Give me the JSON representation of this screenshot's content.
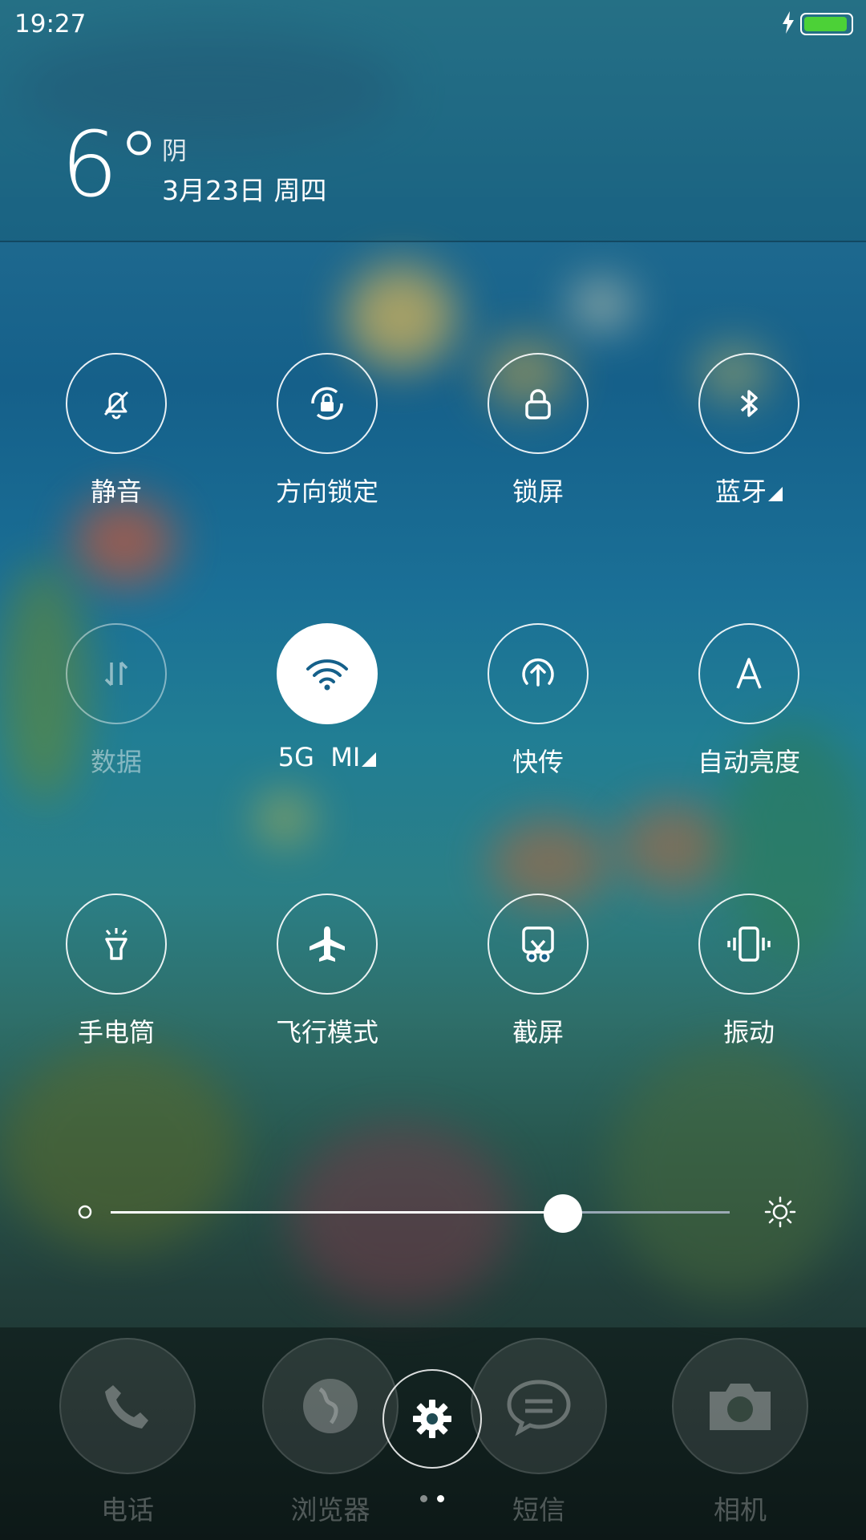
{
  "status_bar": {
    "time": "19:27",
    "battery_level": 0.95,
    "charging": true
  },
  "weather": {
    "temperature": "6°",
    "condition": "阴",
    "date": "3月23日 周四"
  },
  "toggles": [
    {
      "label": "静音",
      "icon": "silent-bell-icon",
      "state": "off"
    },
    {
      "label": "方向锁定",
      "icon": "rotation-lock-icon",
      "state": "off"
    },
    {
      "label": "锁屏",
      "icon": "lock-icon",
      "state": "off"
    },
    {
      "label": "蓝牙",
      "icon": "bluetooth-icon",
      "state": "off",
      "has_menu": true
    },
    {
      "label": "数据",
      "icon": "mobile-data-icon",
      "state": "disabled"
    },
    {
      "label": "5G  MI",
      "icon": "wifi-icon",
      "state": "on",
      "has_menu": true
    },
    {
      "label": "快传",
      "icon": "quick-transfer-icon",
      "state": "off"
    },
    {
      "label": "自动亮度",
      "icon": "auto-brightness-icon",
      "state": "off"
    },
    {
      "label": "手电筒",
      "icon": "flashlight-icon",
      "state": "off"
    },
    {
      "label": "飞行模式",
      "icon": "airplane-icon",
      "state": "off"
    },
    {
      "label": "截屏",
      "icon": "screenshot-icon",
      "state": "off"
    },
    {
      "label": "振动",
      "icon": "vibrate-icon",
      "state": "off"
    }
  ],
  "brightness": {
    "level": 0.73
  },
  "dock": {
    "apps": [
      {
        "label": "电话",
        "icon": "phone-icon"
      },
      {
        "label": "浏览器",
        "icon": "browser-icon"
      },
      {
        "label": "短信",
        "icon": "messages-icon"
      },
      {
        "label": "相机",
        "icon": "camera-icon"
      }
    ],
    "settings_icon": "gear-icon",
    "page_dots": 2,
    "active_page": 2
  },
  "colors": {
    "battery": "#4cd137",
    "background": "#1a6f96"
  }
}
